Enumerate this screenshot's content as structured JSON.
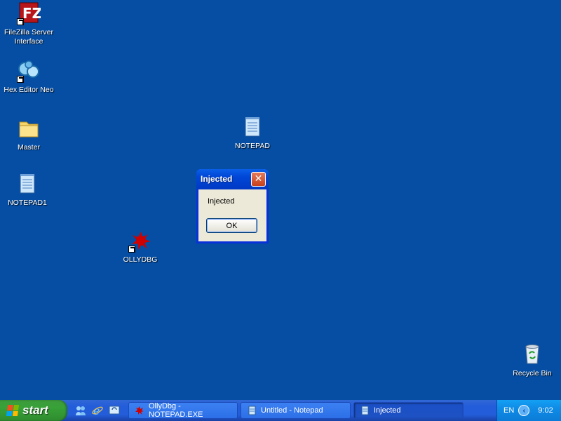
{
  "desktop": {
    "icons": [
      {
        "label": "FileZilla Server\nInterface",
        "icon": "filezilla-icon",
        "shortcut": true
      },
      {
        "label": "Hex Editor Neo",
        "icon": "hex-editor-icon",
        "shortcut": true
      },
      {
        "label": "Master",
        "icon": "folder-icon",
        "shortcut": false
      },
      {
        "label": "NOTEPAD1",
        "icon": "notepad-icon",
        "shortcut": false
      },
      {
        "label": "OLLYDBG",
        "icon": "ollydbg-icon",
        "shortcut": true
      },
      {
        "label": "NOTEPAD",
        "icon": "notepad-icon",
        "shortcut": false
      },
      {
        "label": "Recycle Bin",
        "icon": "recycle-bin-icon",
        "shortcut": false
      }
    ]
  },
  "dialog": {
    "title": "Injected",
    "message": "Injected",
    "ok_label": "OK",
    "close_glyph": "✕"
  },
  "taskbar": {
    "start_label": "start",
    "quick_launch": [
      "msn-messenger-icon",
      "internet-explorer-icon",
      "show-desktop-icon"
    ],
    "tasks": [
      {
        "label": "OllyDbg - NOTEPAD.EXE",
        "icon": "ollydbg-icon",
        "active": false
      },
      {
        "label": "Untitled - Notepad",
        "icon": "notepad-icon",
        "active": false
      },
      {
        "label": "Injected",
        "icon": "notepad-icon",
        "active": true
      }
    ],
    "tray": {
      "language": "EN",
      "clock": "9:02"
    }
  },
  "colors": {
    "desktop": "#054ea4",
    "taskbar": "#245DDA",
    "start": "#38A238",
    "dialog_title": "#0046D6",
    "close": "#C8401B"
  }
}
